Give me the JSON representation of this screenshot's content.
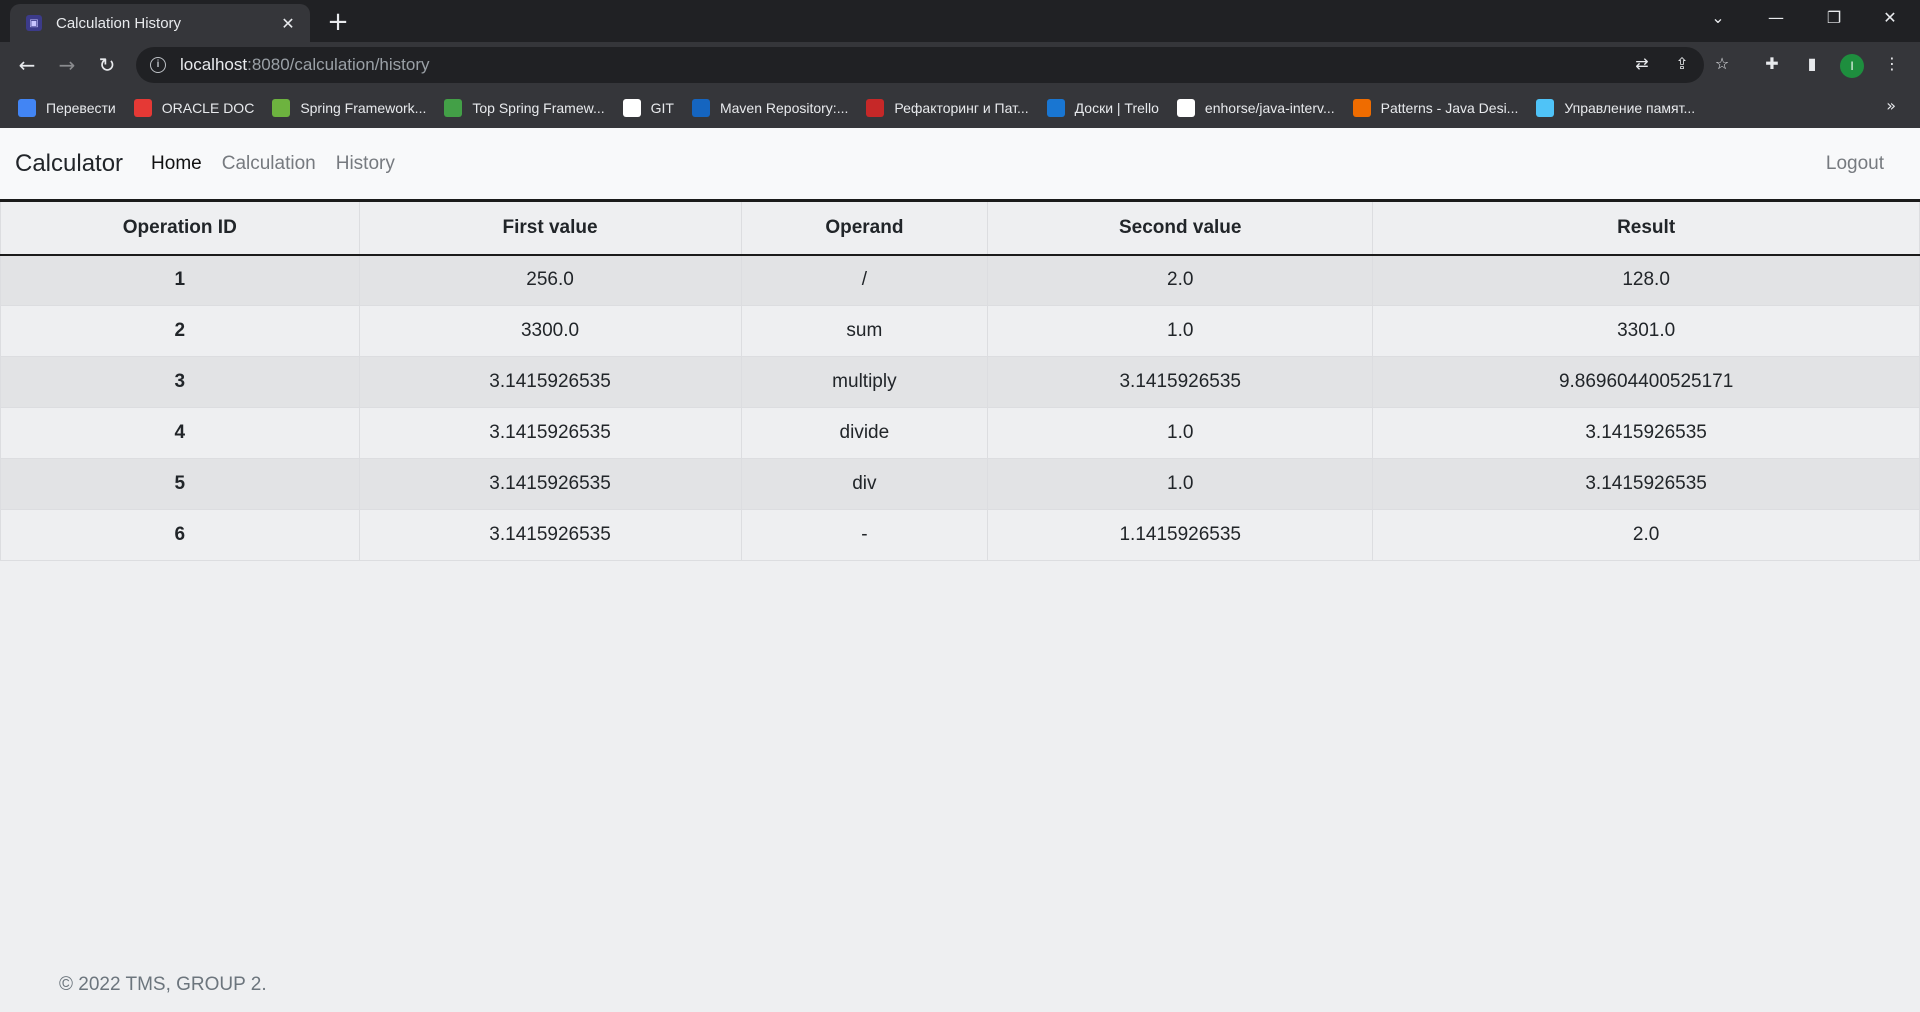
{
  "browser": {
    "tab_title": "Calculation History",
    "url_host": "localhost",
    "url_rest": ":8080/calculation/history",
    "profile_initial": "I",
    "bookmarks": [
      {
        "label": "Перевести",
        "color": "#4285f4"
      },
      {
        "label": "ORACLE DOC",
        "color": "#e53935"
      },
      {
        "label": "Spring Framework...",
        "color": "#6db33f"
      },
      {
        "label": "Top Spring Framew...",
        "color": "#43a047"
      },
      {
        "label": "GIT",
        "color": "#ffffff"
      },
      {
        "label": "Maven Repository:...",
        "color": "#1565c0"
      },
      {
        "label": "Рефакторинг и Пат...",
        "color": "#c62828"
      },
      {
        "label": "Доски | Trello",
        "color": "#1976d2"
      },
      {
        "label": "enhorse/java-interv...",
        "color": "#ffffff"
      },
      {
        "label": "Patterns - Java Desi...",
        "color": "#ef6c00"
      },
      {
        "label": "Управление памят...",
        "color": "#4fc3f7"
      }
    ]
  },
  "nav": {
    "brand": "Calculator",
    "links": [
      "Home",
      "Calculation",
      "History"
    ],
    "logout": "Logout"
  },
  "table": {
    "headers": [
      "Operation ID",
      "First value",
      "Operand",
      "Second value",
      "Result"
    ],
    "rows": [
      [
        "1",
        "256.0",
        "/",
        "2.0",
        "128.0"
      ],
      [
        "2",
        "3300.0",
        "sum",
        "1.0",
        "3301.0"
      ],
      [
        "3",
        "3.1415926535",
        "multiply",
        "3.1415926535",
        "9.869604400525171"
      ],
      [
        "4",
        "3.1415926535",
        "divide",
        "1.0",
        "3.1415926535"
      ],
      [
        "5",
        "3.1415926535",
        "div",
        "1.0",
        "3.1415926535"
      ],
      [
        "6",
        "3.1415926535",
        "-",
        "1.1415926535",
        "2.0"
      ]
    ]
  },
  "footer": "© 2022 TMS, GROUP 2."
}
